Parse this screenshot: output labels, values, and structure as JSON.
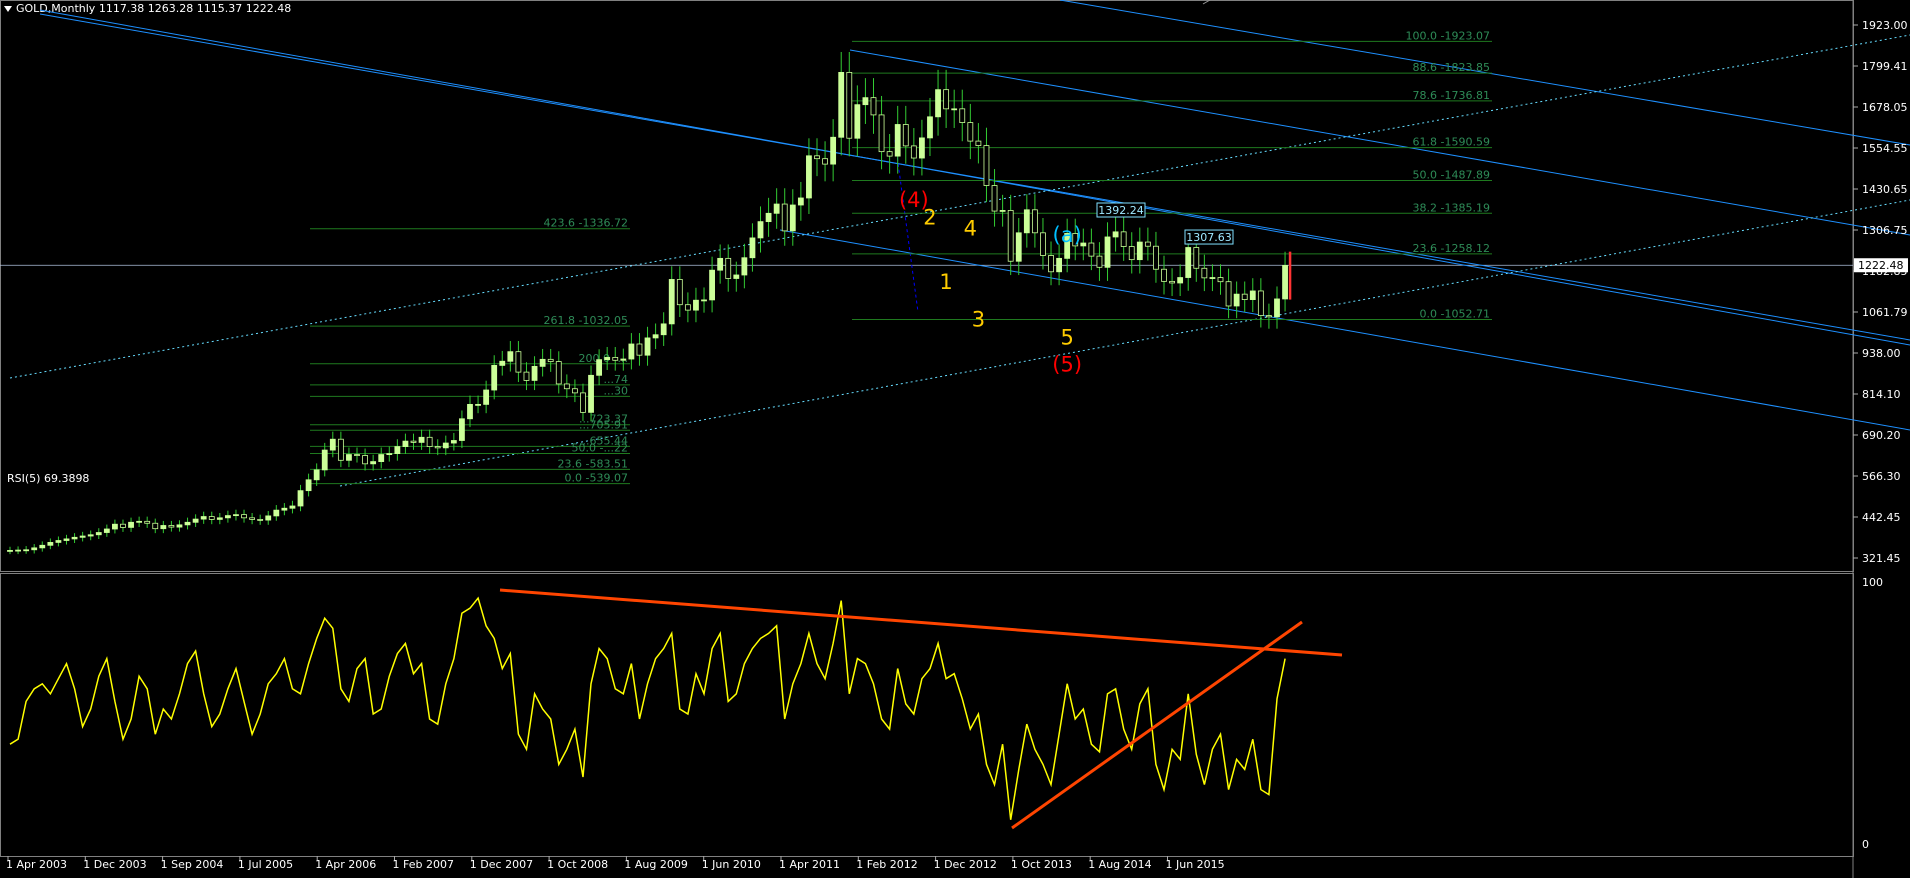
{
  "header": {
    "symbol_line": "GOLD,Monthly  1117.38 1263.28 1115.37 1222.48",
    "rsi_line": "RSI(5) 69.3898"
  },
  "colors": {
    "background": "#000000",
    "grid": "#ffffff",
    "bull_body": "#ccff99",
    "bear_body": "#000000",
    "wick": "#33cc33",
    "channel": "#1e90ff",
    "fib": "#1f7a1f",
    "fib_text": "#2e8b57",
    "rsi_line": "#ffff00",
    "trend": "#ff4500",
    "wave_red": "#ff0000",
    "wave_yellow": "#ffcc00",
    "wave_cyan": "#00bfff"
  },
  "price_axis": {
    "labels": [
      "1923.00",
      "1799.41",
      "1678.05",
      "1554.55",
      "1430.65",
      "1306.75",
      "1182.85",
      "1061.79",
      "938.00",
      "814.10",
      "690.20",
      "566.30",
      "442.45",
      "321.45"
    ],
    "current": "1222.48"
  },
  "rsi_axis": {
    "labels": [
      "100",
      "0"
    ]
  },
  "time_axis": {
    "labels": [
      "1 Apr 2003",
      "1 Dec 2003",
      "1 Sep 2004",
      "1 Jul 2005",
      "1 Apr 2006",
      "1 Feb 2007",
      "1 Dec 2007",
      "1 Oct 2008",
      "1 Aug 2009",
      "1 Jun 2010",
      "1 Apr 2011",
      "1 Feb 2012",
      "1 Dec 2012",
      "1 Oct 2013",
      "1 Aug 2014",
      "1 Jun 2015"
    ]
  },
  "fib_upper": [
    {
      "label": "100.0 -1923.07",
      "price": 1923.07
    },
    {
      "label": "88.6 -1823.85",
      "price": 1823.85
    },
    {
      "label": "78.6 -1736.81",
      "price": 1736.81
    },
    {
      "label": "61.8 -1590.59",
      "price": 1590.59
    },
    {
      "label": "50.0 -1487.89",
      "price": 1487.89
    },
    {
      "label": "38.2 -1385.19",
      "price": 1385.19
    },
    {
      "label": "23.6 -1258.12",
      "price": 1258.12
    },
    {
      "label": "0.0 -1052.71",
      "price": 1052.71
    }
  ],
  "fib_ext": [
    {
      "label": "423.6 -1336.72",
      "price": 1336.72
    },
    {
      "label": "261.8 -1032.05",
      "price": 1032.05
    }
  ],
  "fib_lower": [
    {
      "label": "200.0 -...",
      "price": 914
    },
    {
      "label": "...74",
      "price": 848
    },
    {
      "label": "...30",
      "price": 812
    },
    {
      "label": "...723.37",
      "price": 723.37
    },
    {
      "label": "...705.91",
      "price": 705.91
    },
    {
      "label": "...655.44",
      "price": 655.44
    },
    {
      "label": "50.0 -...22",
      "price": 633.22
    },
    {
      "label": "23.6 -583.51",
      "price": 583.51
    },
    {
      "label": "0.0 -539.07",
      "price": 539.07
    }
  ],
  "price_tags": [
    "1392.24",
    "1307.63"
  ],
  "waves": [
    {
      "text": "(4)",
      "color_key": "wave_red",
      "bar": 112,
      "price": 1405
    },
    {
      "text": "2",
      "color_key": "wave_yellow",
      "bar": 114,
      "price": 1350
    },
    {
      "text": "4",
      "color_key": "wave_yellow",
      "bar": 119,
      "price": 1315
    },
    {
      "text": "(a)",
      "color_key": "wave_cyan",
      "bar": 131,
      "price": 1295
    },
    {
      "text": "1",
      "color_key": "wave_yellow",
      "bar": 116,
      "price": 1148
    },
    {
      "text": "3",
      "color_key": "wave_yellow",
      "bar": 120,
      "price": 1030
    },
    {
      "text": "5",
      "color_key": "wave_yellow",
      "bar": 131,
      "price": 975
    },
    {
      "text": "(5)",
      "color_key": "wave_red",
      "bar": 131,
      "price": 890
    }
  ],
  "chart_data": {
    "type": "candlestick",
    "title": "GOLD,Monthly",
    "series": [
      {
        "name": "GOLD",
        "close": [
          330,
          331,
          332,
          338,
          346,
          355,
          361,
          366,
          371,
          375,
          379,
          386,
          397,
          412,
          402,
          418,
          421,
          415,
          398,
          408,
          403,
          410,
          418,
          428,
          436,
          427,
          432,
          439,
          442,
          432,
          427,
          425,
          438,
          456,
          462,
          469,
          517,
          551,
          582,
          644,
          678,
          612,
          630,
          627,
          601,
          608,
          630,
          633,
          655,
          672,
          668,
          684,
          655,
          651,
          666,
          674,
          742,
          787,
          787,
          832,
          909,
          922,
          952,
          888,
          862,
          906,
          928,
          921,
          851,
          836,
          823,
          762,
          878,
          927,
          934,
          925,
          929,
          976,
          941,
          995,
          1005,
          1039,
          1178,
          1099,
          1082,
          1113,
          1114,
          1207,
          1244,
          1181,
          1192,
          1246,
          1308,
          1359,
          1385,
          1414,
          1330,
          1411,
          1433,
          1565,
          1556,
          1539,
          1623,
          1826,
          1620,
          1725,
          1747,
          1693,
          1578,
          1564,
          1663,
          1596,
          1558,
          1621,
          1687,
          1772,
          1712,
          1712,
          1669,
          1611,
          1597,
          1472,
          1392,
          1394,
          1235,
          1324,
          1396,
          1324,
          1253,
          1202,
          1244,
          1322,
          1283,
          1292,
          1251,
          1216,
          1311,
          1327,
          1281,
          1240,
          1295,
          1282,
          1210,
          1172,
          1167,
          1184,
          1278,
          1213,
          1183,
          1184,
          1171,
          1095,
          1132,
          1115,
          1142,
          1065,
          1061,
          1117,
          1222
        ]
      }
    ],
    "rsi_close": [
      38,
      40,
      55,
      60,
      62,
      58,
      64,
      70,
      60,
      45,
      52,
      65,
      72,
      55,
      40,
      48,
      65,
      60,
      42,
      52,
      48,
      58,
      70,
      75,
      58,
      45,
      50,
      60,
      68,
      55,
      42,
      50,
      62,
      66,
      72,
      60,
      58,
      70,
      80,
      88,
      84,
      60,
      55,
      68,
      72,
      50,
      52,
      65,
      74,
      78,
      66,
      70,
      48,
      46,
      62,
      72,
      90,
      92,
      96,
      85,
      80,
      68,
      74,
      42,
      36,
      58,
      52,
      48,
      30,
      36,
      44,
      25,
      62,
      76,
      72,
      60,
      58,
      70,
      48,
      62,
      72,
      76,
      82,
      52,
      50,
      66,
      58,
      76,
      82,
      55,
      58,
      70,
      76,
      80,
      82,
      85,
      48,
      62,
      70,
      82,
      70,
      64,
      78,
      95,
      58,
      72,
      70,
      62,
      48,
      44,
      68,
      54,
      50,
      64,
      68,
      78,
      64,
      66,
      56,
      44,
      50,
      30,
      22,
      38,
      8,
      28,
      46,
      36,
      30,
      22,
      42,
      62,
      48,
      52,
      38,
      35,
      58,
      60,
      44,
      36,
      54,
      60,
      30,
      20,
      36,
      32,
      58,
      34,
      22,
      36,
      42,
      20,
      32,
      28,
      40,
      20,
      18,
      56,
      72
    ],
    "price_min": 300,
    "price_max": 1990,
    "rsi_min": 0,
    "rsi_max": 100,
    "grid": false
  }
}
